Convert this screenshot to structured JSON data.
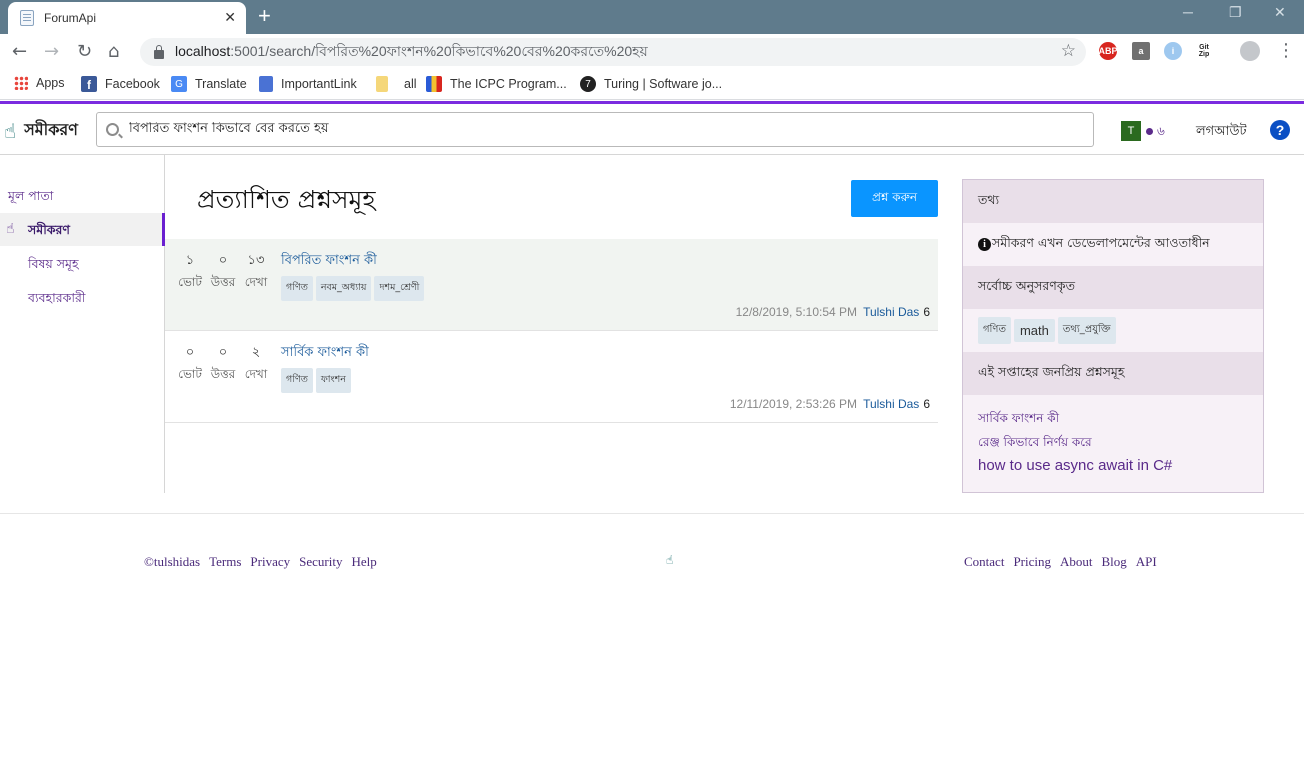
{
  "browser": {
    "tab_title": "ForumApi",
    "tab_close": "✕",
    "new_tab": "+",
    "url_host": "localhost",
    "url_path": ":5001/search/বিপরিত%20ফাংশন%20কিভাবে%20বের%20করতে%20হয়",
    "bookmarks": [
      "Apps",
      "Facebook",
      "Translate",
      "ImportantLink",
      "all",
      "The ICPC Program...",
      "Turing | Software jo..."
    ],
    "extensions": [
      "ABP",
      "a",
      "i",
      "Git Zip"
    ]
  },
  "header": {
    "logo_text": "সমীকরণ",
    "search_value": "বিপরিত ফাংশন কিভাবে বের করতে হয়",
    "avatar_letter": "T",
    "reputation": "৬",
    "logout_label": "লগআউট",
    "help_label": "?"
  },
  "leftnav": {
    "home": "মূল পাতা",
    "active": "সমীকরণ",
    "topics": "বিষয় সমূহ",
    "users": "ব্যবহারকারী"
  },
  "main": {
    "title": "প্রত্যাশিত প্রশ্নসমূহ",
    "ask_button": "প্রশ্ন করুন",
    "stat_labels": {
      "votes": "ভোট",
      "answers": "উত্তর",
      "views": "দেখা"
    },
    "questions": [
      {
        "votes": "১",
        "answers": "০",
        "views": "১৩",
        "title": "বিপরিত ফাংশন কী",
        "tags": [
          "গণিত",
          "নবম_অধ্যায়",
          "দশম_শ্রেণী"
        ],
        "date": "12/8/2019, 5:10:54 PM",
        "user": "Tulshi Das",
        "user_rep": "6"
      },
      {
        "votes": "০",
        "answers": "০",
        "views": "২",
        "title": "সার্বিক ফাংশন কী",
        "tags": [
          "গণিত",
          "ফাংশন"
        ],
        "date": "12/11/2019, 2:53:26 PM",
        "user": "Tulshi Das",
        "user_rep": "6"
      }
    ]
  },
  "sidebar": {
    "info_heading": "তথ্য",
    "info_text": "সমীকরণ এখন ডেভেলাপমেন্টের আওতাধীন",
    "followed_heading": "সর্বোচ্চ অনুসরণকৃত",
    "followed_tags": [
      "গণিত",
      "math",
      "তথ্য_প্রযুক্তি"
    ],
    "popular_heading": "এই সপ্তাহের জনপ্রিয় প্রশ্নসমূহ",
    "popular_links": [
      "সার্বিক ফাংশন কী",
      "রেঞ্জ কিভাবে নির্ণয় করে",
      "how to use async await in C#"
    ]
  },
  "footer": {
    "left_links": [
      "©tulshidas",
      "Terms",
      "Privacy",
      "Security",
      "Help"
    ],
    "right_links": [
      "Contact",
      "Pricing",
      "About",
      "Blog",
      "API"
    ]
  },
  "colors": {
    "accent": "#7b2be0",
    "ask_button": "#0a95ff",
    "link": "#5a2a8a",
    "browser_frame": "#5f7b8c"
  }
}
